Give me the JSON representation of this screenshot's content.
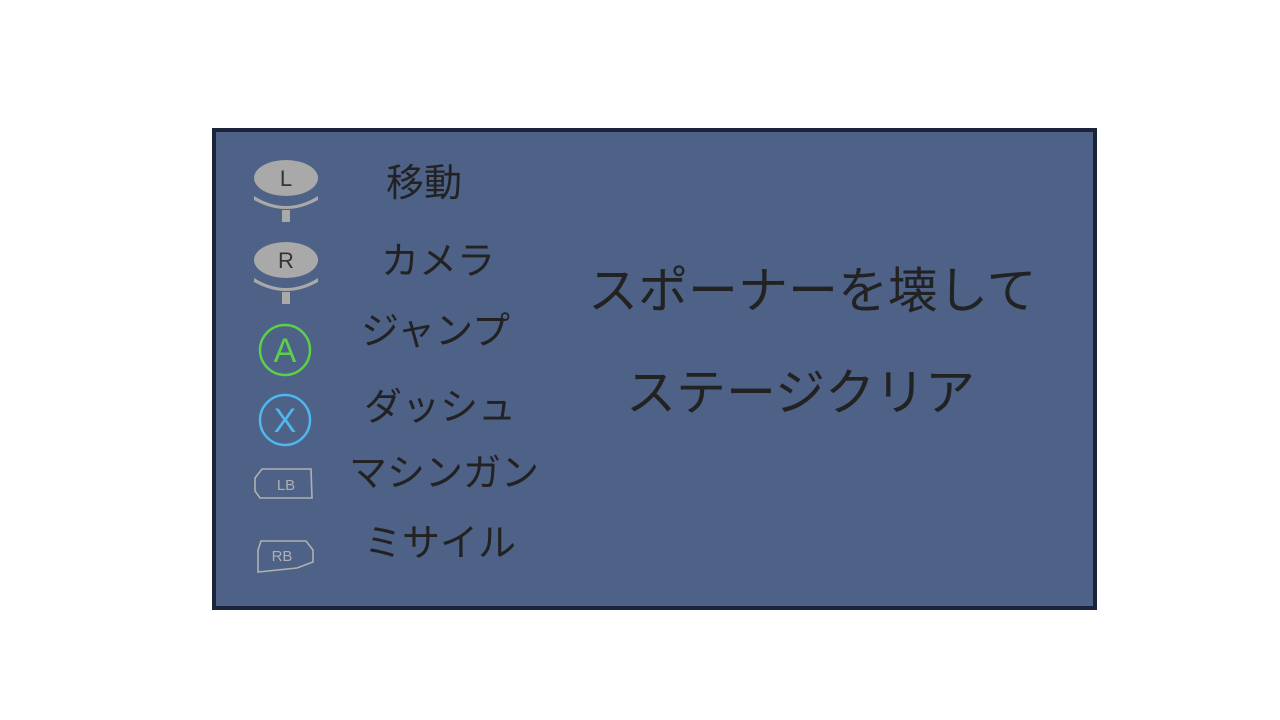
{
  "controls": [
    {
      "icon": "left-stick-icon",
      "button": "L",
      "action": "移動"
    },
    {
      "icon": "right-stick-icon",
      "button": "R",
      "action": "カメラ"
    },
    {
      "icon": "a-button-icon",
      "button": "A",
      "action": "ジャンプ"
    },
    {
      "icon": "x-button-icon",
      "button": "X",
      "action": "ダッシュ"
    },
    {
      "icon": "lb-button-icon",
      "button": "LB",
      "action": "マシンガン"
    },
    {
      "icon": "rb-button-icon",
      "button": "RB",
      "action": "ミサイル"
    }
  ],
  "objective": {
    "line1": "スポーナーを壊して",
    "line2": "ステージクリア"
  },
  "colors": {
    "panel_bg": "#4e6186",
    "panel_border": "#1b2438",
    "text": "#222222",
    "stick": "#a9a9a9",
    "a_button": "#5bd04b",
    "x_button": "#4fb6ee",
    "bumper": "#b0b0b0"
  }
}
